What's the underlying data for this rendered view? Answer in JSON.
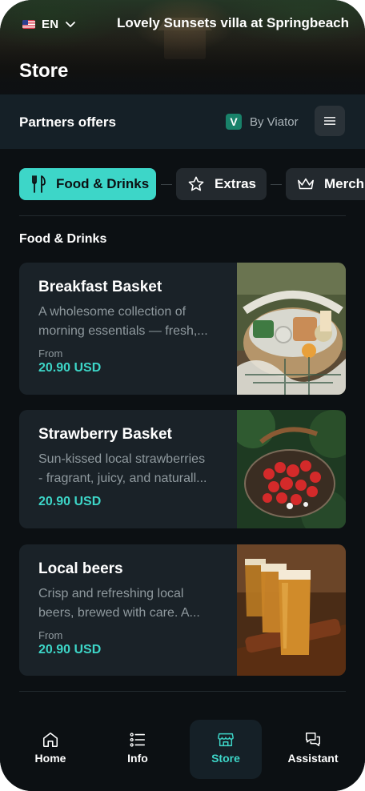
{
  "header": {
    "language_code": "EN",
    "villa_name": "Lovely Sunsets villa at Springbeach",
    "page_title": "Store"
  },
  "partners": {
    "label": "Partners offers",
    "provider_text": "By Viator",
    "provider_logo_letter": "V",
    "provider_color": "#19826a"
  },
  "categories": [
    {
      "label": "Food & Drinks",
      "icon": "fork-knife-icon",
      "active": true
    },
    {
      "label": "Extras",
      "icon": "star-icon",
      "active": false
    },
    {
      "label": "Merch",
      "icon": "crown-icon",
      "active": false
    }
  ],
  "section_title": "Food & Drinks",
  "products": [
    {
      "name": "Breakfast Basket",
      "desc_line1": "A wholesome collection of",
      "desc_line2": "morning essentials — fresh,...",
      "from_label": "From",
      "price": "20.90 USD"
    },
    {
      "name": "Strawberry Basket",
      "desc_line1": "Sun-kissed local strawberries",
      "desc_line2": "- fragrant, juicy, and naturall...",
      "price": "20.90 USD"
    },
    {
      "name": "Local beers",
      "desc_line1": "Crisp and refreshing local",
      "desc_line2": "beers, brewed with care. A...",
      "from_label": "From",
      "price": "20.90 USD"
    }
  ],
  "nav": [
    {
      "label": "Home",
      "icon": "home-icon",
      "active": false
    },
    {
      "label": "Info",
      "icon": "list-icon",
      "active": false
    },
    {
      "label": "Store",
      "icon": "store-icon",
      "active": true
    },
    {
      "label": "Assistant",
      "icon": "chat-icon",
      "active": false
    }
  ],
  "colors": {
    "accent": "#3dd6c8",
    "background": "#0c1013",
    "card": "#1a2228"
  }
}
